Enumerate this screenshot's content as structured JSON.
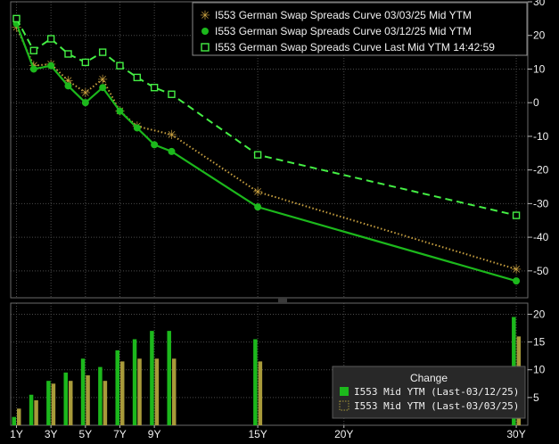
{
  "chart_data": [
    {
      "type": "line",
      "x": [
        "1Y",
        "2Y",
        "3Y",
        "4Y",
        "5Y",
        "6Y",
        "7Y",
        "8Y",
        "9Y",
        "10Y",
        "15Y",
        "30Y"
      ],
      "tick_labels_x": [
        "1Y",
        "3Y",
        "5Y",
        "7Y",
        "9Y",
        "15Y",
        "20Y",
        "30Y"
      ],
      "ylim": [
        -58,
        30
      ],
      "y_ticks": [
        30,
        20,
        10,
        0,
        -10,
        -20,
        -30,
        -40,
        -50
      ],
      "grid": true,
      "legend": "top-right",
      "series": [
        {
          "name": "I553 German Swap Spreads Curve 03/03/25 Mid YTM",
          "color": "#c8a040",
          "marker": "star",
          "style": "dotted",
          "values": [
            22.5,
            11,
            11.5,
            6.5,
            3,
            7,
            -2.5,
            -7,
            -9.5,
            -26.5,
            -49.5
          ]
        },
        {
          "name": "I553 German Swap Spreads Curve 03/12/25 Mid YTM",
          "color": "#1cb81c",
          "marker": "circle",
          "style": "solid",
          "values": [
            23.5,
            10,
            11,
            5,
            0,
            4.5,
            -2.5,
            -7.5,
            -12.5,
            -14.5,
            -31,
            -53
          ]
        },
        {
          "name": "I553 German Swap Spreads Curve Last Mid YTM 14:42:59",
          "color": "#44ee44",
          "marker": "square",
          "style": "dashed",
          "values": [
            25,
            15.5,
            19,
            14.5,
            12,
            15,
            11,
            7.5,
            4.5,
            2.5,
            -15.5,
            -33.5
          ]
        }
      ]
    },
    {
      "type": "bar",
      "categories": [
        "1Y",
        "2Y",
        "3Y",
        "4Y",
        "5Y",
        "6Y",
        "7Y",
        "8Y",
        "9Y",
        "10Y",
        "15Y",
        "30Y"
      ],
      "ylim": [
        0,
        22
      ],
      "y_ticks": [
        5,
        10,
        15,
        20
      ],
      "legend": "bottom-right",
      "legend_title": "Change",
      "series": [
        {
          "name": "I553 Mid YTM (Last-03/12/25)",
          "color": "#1cb81c",
          "values": [
            1.5,
            5.5,
            8,
            9.5,
            12,
            10.5,
            13.5,
            15.5,
            17,
            17,
            15.5,
            19.5
          ]
        },
        {
          "name": "I553 Mid YTM (Last-03/03/25)",
          "color": "#a89a3a",
          "values": [
            3,
            4.5,
            7.5,
            8,
            9,
            8,
            11.5,
            12,
            12,
            12,
            11.5,
            16
          ]
        }
      ]
    }
  ]
}
